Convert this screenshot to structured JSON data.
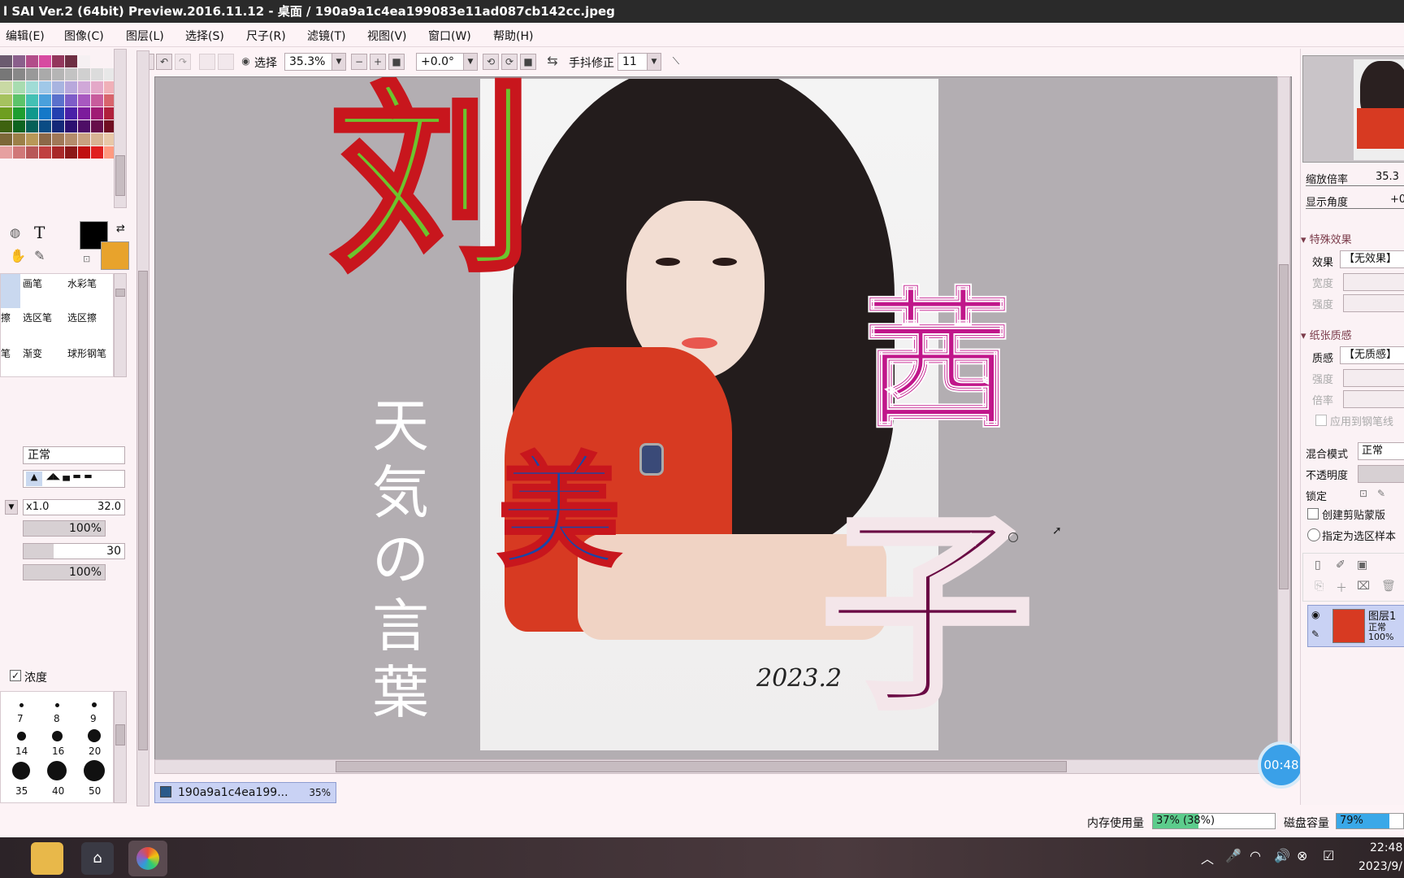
{
  "window": {
    "title": "l SAI Ver.2 (64bit) Preview.2016.11.12 - 桌面 / 190a9a1c4ea199083e11ad087cb142cc.jpeg"
  },
  "menu": [
    "编辑(E)",
    "图像(C)",
    "图层(L)",
    "选择(S)",
    "尺子(R)",
    "滤镜(T)",
    "视图(V)",
    "窗口(W)",
    "帮助(H)"
  ],
  "toolbar": {
    "select_label": "选择",
    "zoom": "35.3%",
    "angle": "+0.0°",
    "stabilizer_label": "手抖修正",
    "stabilizer_value": "11"
  },
  "tools": {
    "text_tool": "T",
    "brushes": [
      "画笔",
      "水彩笔",
      "选区笔",
      "选区擦",
      "渐变",
      "球形钢笔"
    ],
    "partial": [
      "擦",
      "笔"
    ]
  },
  "brush_settings": {
    "mode": "正常",
    "size_mult": "x1.0",
    "size": "32.0",
    "min_size": "100%",
    "density": "30",
    "density_pct": "100%",
    "density_label": "浓度"
  },
  "brush_sizes": [
    "7",
    "8",
    "9",
    "14",
    "16",
    "20",
    "35",
    "40",
    "50"
  ],
  "colors": {
    "primary": "#000000",
    "secondary": "#e8a32c",
    "accent": "#3aa0e8"
  },
  "artwork": {
    "chars": [
      "刘",
      "茜",
      "美",
      "子"
    ],
    "vertical_text": [
      "天",
      "気",
      "の",
      "言",
      "葉"
    ],
    "signature": "2023.2"
  },
  "document_tab": {
    "name": "190a9a1c4ea199...",
    "zoom": "35%"
  },
  "navigator": {
    "zoom_label": "缩放倍率",
    "zoom_value": "35.3",
    "angle_label": "显示角度",
    "angle_value": "+0"
  },
  "effects": {
    "header": "特殊效果",
    "effect_label": "效果",
    "effect_value": "【无效果】",
    "width_label": "宽度",
    "strength_label": "强度"
  },
  "paper": {
    "header": "纸张质感",
    "texture_label": "质感",
    "texture_value": "【无质感】",
    "strength_label": "强度",
    "scale_label": "倍率",
    "apply_label": "应用到钢笔线"
  },
  "layer_props": {
    "blend_label": "混合模式",
    "blend_value": "正常",
    "opacity_label": "不透明度",
    "lock_label": "锁定",
    "clip_label": "创建剪贴蒙版",
    "sample_label": "指定为选区样本"
  },
  "layer": {
    "name": "图层1",
    "mode": "正常",
    "opacity": "100%"
  },
  "timer": "00:48",
  "status": {
    "memory_label": "内存使用量",
    "memory_value": "37% (38%)",
    "memory_fraction": 0.37,
    "disk_label": "磁盘容量",
    "disk_value": "79%",
    "disk_fraction": 0.79
  },
  "taskbar": {
    "time": "22:48",
    "date": "2023/9/"
  }
}
